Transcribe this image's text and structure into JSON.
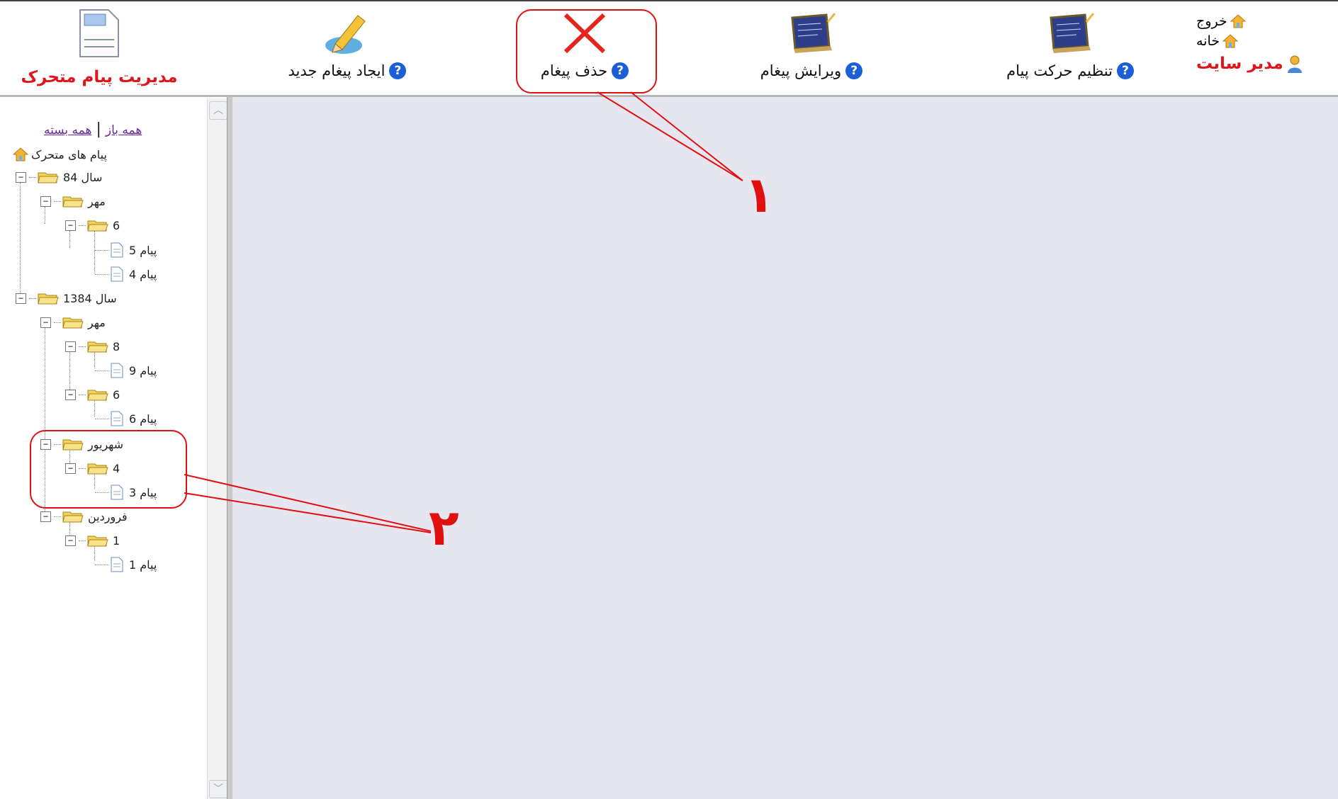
{
  "toolbar": {
    "brand_title": "مدیریت پیام متحرک",
    "brand_icon": "page-icon",
    "buttons": [
      {
        "label": "ایجاد پیغام جدید",
        "icon": "pencil-icon"
      },
      {
        "label": "حذف پیغام",
        "icon": "delete-x-icon"
      },
      {
        "label": "ویرایش پیغام",
        "icon": "blackboard-icon"
      },
      {
        "label": "تنظیم حرکت پیام",
        "icon": "blackboard-icon"
      }
    ],
    "help_glyph": "?",
    "top_right": {
      "exit": "خروج",
      "home": "خانه",
      "site_admin": "مدیر سایت"
    }
  },
  "tree": {
    "expand_all": "همه باز",
    "collapse_all": "همه بسته",
    "separator": "|",
    "root": "پیام های متحرک",
    "nodes": [
      {
        "label": "سال 84"
      },
      {
        "label": "مهر"
      },
      {
        "label": "6"
      },
      {
        "label": "پیام 5"
      },
      {
        "label": "پیام 4"
      },
      {
        "label": "سال 1384"
      },
      {
        "label": "مهر"
      },
      {
        "label": "8"
      },
      {
        "label": "پیام 9"
      },
      {
        "label": "6"
      },
      {
        "label": "پیام 6"
      },
      {
        "label": "شهریور"
      },
      {
        "label": "4"
      },
      {
        "label": "پیام 3"
      },
      {
        "label": "فروردین"
      },
      {
        "label": "1"
      },
      {
        "label": "پیام 1"
      }
    ]
  },
  "annotations": {
    "one": "۱",
    "two": "۲"
  },
  "colors": {
    "accent_red": "#e0151b",
    "content_bg": "#e6e6f1",
    "help_blue": "#1a5fd6"
  }
}
